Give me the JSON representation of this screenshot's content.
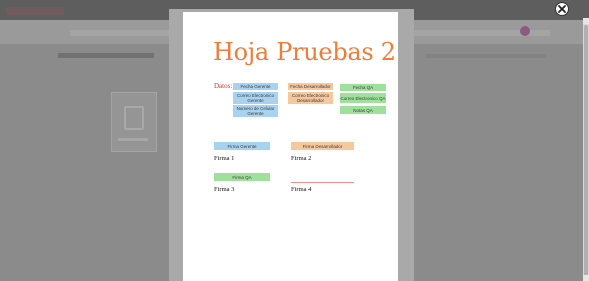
{
  "window": {
    "close_icon": "close-circle-icon"
  },
  "document": {
    "title": "Hoja Pruebas 2",
    "datos_label": "Datos:",
    "fields": {
      "fecha_gerente": "Fecha Gerente",
      "correo_gerente": "Correo Electronico Gerente",
      "celular_gerente": "Numero de Celular Gerente",
      "fecha_desarrollador": "Fecha Desarrollador",
      "correo_desarrollador": "Correo Electronico Desarrollador",
      "fecha_qa": "Fecha QA",
      "correo_qa": "Correo Electronico QA",
      "notas_qa": "Notas QA"
    },
    "signatures": {
      "firma_gerente_field": "Firma Gerente",
      "firma_desarrollador_field": "Firma Desarrollador",
      "firma_qa_field": "Firma QA",
      "firma1": "Firma 1",
      "firma2": "Firma 2",
      "firma3": "Firma 3",
      "firma4": "Firma 4"
    }
  },
  "colors": {
    "title": "#ee7d3b",
    "datos": "#e0302c",
    "gerente_field": "#a8d3f0",
    "desarrollador_field": "#f6c89d",
    "qa_field": "#9fe09c"
  }
}
